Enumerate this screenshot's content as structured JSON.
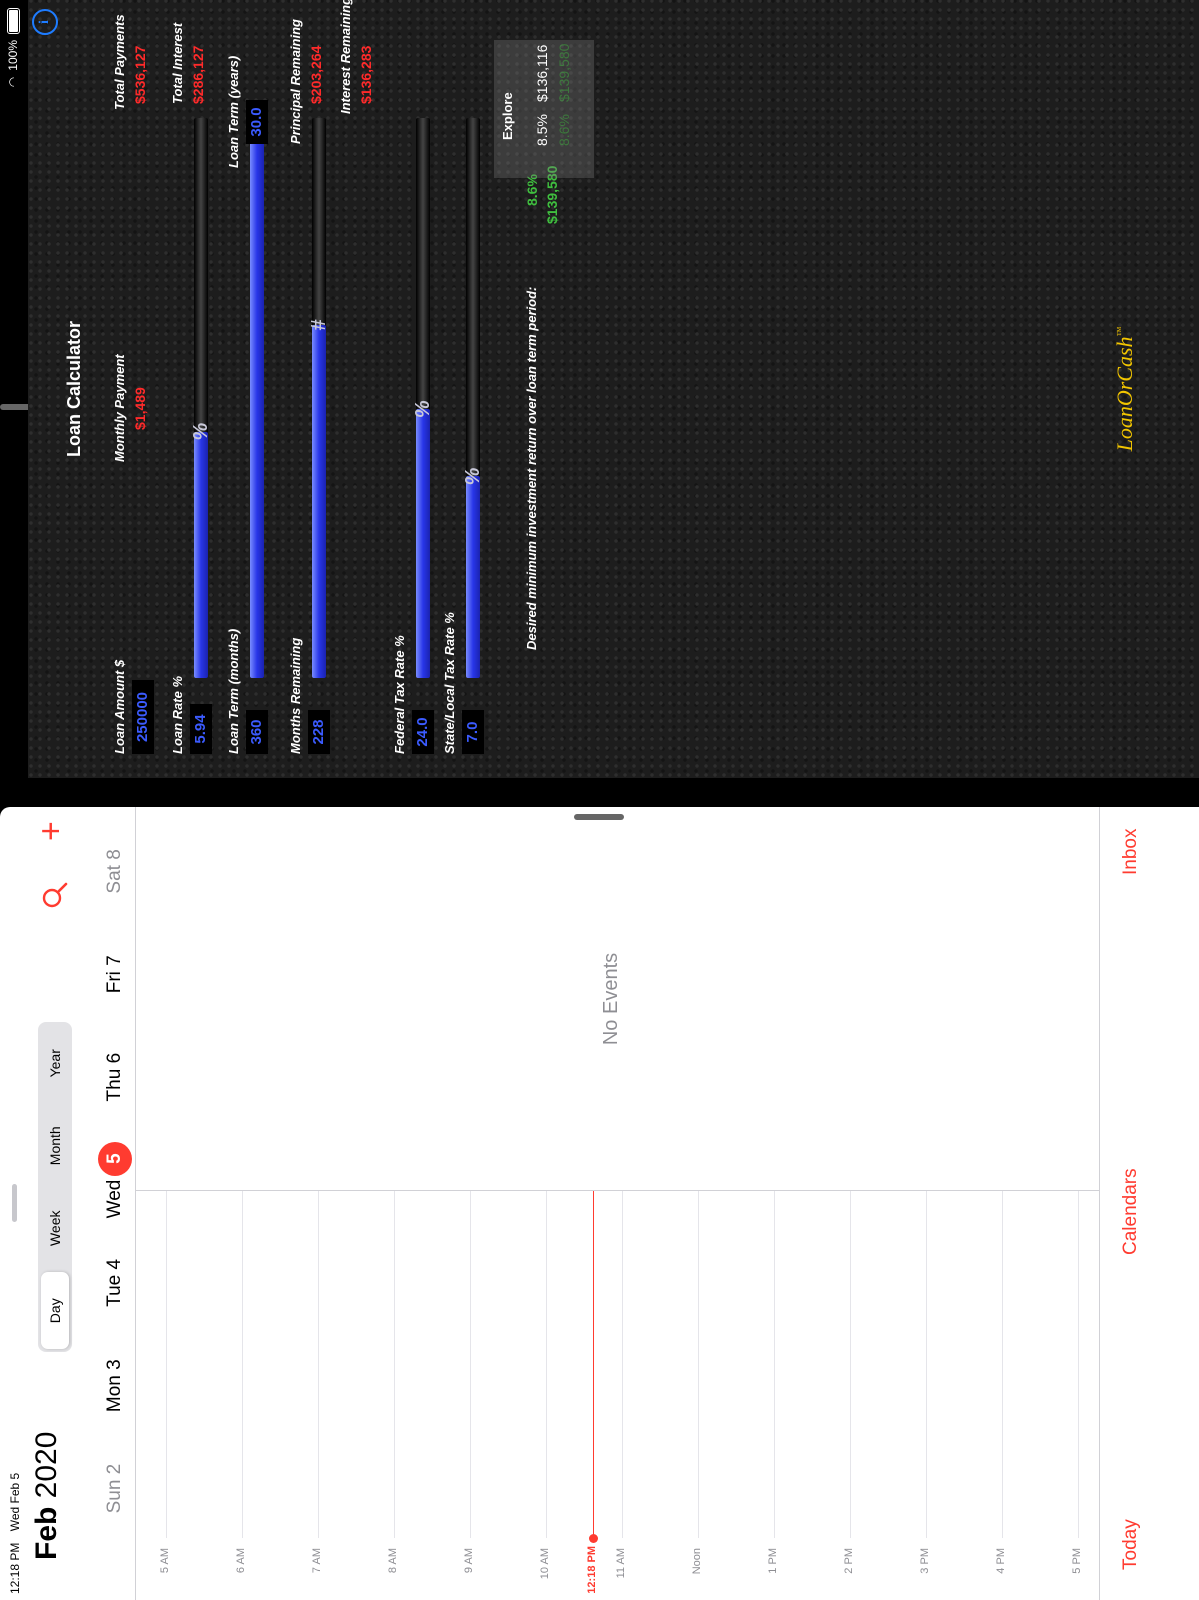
{
  "status": {
    "time": "12:18 PM",
    "date": "Wed Feb 5",
    "battery": "100%"
  },
  "calendar": {
    "month": "Feb",
    "year": "2020",
    "view_modes": [
      "Day",
      "Week",
      "Month",
      "Year"
    ],
    "active_view": "Day",
    "days": [
      {
        "label": "Sun 2"
      },
      {
        "label": "Mon 3"
      },
      {
        "label": "Tue 4"
      },
      {
        "label": "Wed",
        "badge": "5"
      },
      {
        "label": "Thu 6"
      },
      {
        "label": "Fri 7"
      },
      {
        "label": "Sat 8"
      }
    ],
    "hours": [
      "5 AM",
      "6 AM",
      "7 AM",
      "8 AM",
      "9 AM",
      "10 AM",
      "11 AM",
      "Noon",
      "1 PM",
      "2 PM",
      "3 PM",
      "4 PM",
      "5 PM"
    ],
    "now_label": "12:18 PM",
    "empty_text": "No Events",
    "tabs": {
      "today": "Today",
      "calendars": "Calendars",
      "inbox": "Inbox"
    },
    "accent": "#ff3b30"
  },
  "loan": {
    "title": "Loan Calculator",
    "loan_amount_label": "Loan Amount $",
    "loan_amount": "250000",
    "monthly_payment_label": "Monthly Payment",
    "monthly_payment": "$1,489",
    "total_payments_label": "Total Payments",
    "total_payments": "$536,127",
    "total_interest_label": "Total Interest",
    "total_interest": "$286,127",
    "loan_rate_label": "Loan Rate %",
    "loan_rate": "5.94",
    "loan_rate_fill": 0.44,
    "loan_term_months_label": "Loan Term (months)",
    "loan_term_months": "360",
    "loan_term_years_label": "Loan Term (years)",
    "loan_term_years": "30.0",
    "loan_term_fill": 1.0,
    "months_remaining_label": "Months Remaining",
    "months_remaining": "228",
    "months_remaining_fill": 0.63,
    "principal_remaining_label": "Principal Remaining",
    "principal_remaining": "$203,264",
    "interest_remaining_label": "Interest Remaining",
    "interest_remaining": "$136,283",
    "federal_tax_label": "Federal Tax Rate %",
    "federal_tax": "24.0",
    "federal_tax_fill": 0.48,
    "state_tax_label": "State/Local Tax Rate %",
    "state_tax": "7.0",
    "state_tax_fill": 0.36,
    "desired_return_label": "Desired minimum investment return over loan term period:",
    "desired_rate": "8.6%",
    "desired_amount": "$139,580",
    "explore_label": "Explore",
    "explore_rows": [
      {
        "rate": "8.5%",
        "amount": "$136,116"
      },
      {
        "rate": "8.6%",
        "amount": "$139,580"
      }
    ],
    "logo": "LoanOrCash",
    "logo_tm": "™"
  }
}
